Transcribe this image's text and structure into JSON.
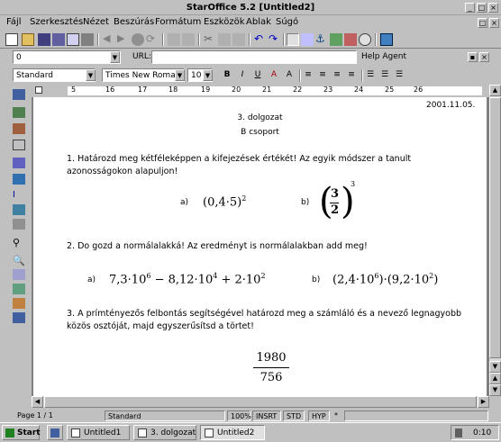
{
  "window": {
    "title": "StarOffice 5.2   [Untitled2]"
  },
  "menu": [
    "Fájl",
    "Szerkesztés",
    "Nézet",
    "Beszúrás",
    "Formátum",
    "Eszközök",
    "Ablak",
    "Súgó"
  ],
  "function_bar": {
    "url_label": "URL:",
    "url_value": "",
    "path_value": "0",
    "help_agent": "Help Agent"
  },
  "format_bar": {
    "style": "Standard",
    "font": "Times New Roman",
    "size": "10",
    "bold": "B",
    "italic": "I",
    "underline": "U"
  },
  "ruler": {
    "labels": [
      "5",
      "16",
      "17",
      "18",
      "19",
      "20",
      "21",
      "22",
      "23",
      "24",
      "25",
      "26"
    ]
  },
  "document": {
    "date": "2001.11.05.",
    "heading": "3. dolgozat",
    "group": "B csoport",
    "q1": "1. Határozd meg kétféleképpen a kifejezések értékét! Az egyik módszer a tanult azonosságokon alapuljon!",
    "q1_a_label": "a)",
    "q1_a_expr": "(0,4·5)",
    "q1_a_exp": "2",
    "q1_b_label": "b)",
    "q1_b_num": "3",
    "q1_b_den": "2",
    "q1_b_exp": "3",
    "q2": "2. Do gozd a normálalakká! Az eredményt is normálalakban add meg!",
    "q2_a_label": "a)",
    "q2_a_expr_1": "7,3·10",
    "q2_a_exp_1": "6",
    "q2_a_expr_2": " − 8,12·10",
    "q2_a_exp_2": "4",
    "q2_a_expr_3": " + 2·10",
    "q2_a_exp_3": "2",
    "q2_b_label": "b)",
    "q2_b_expr_1": "(2,4·10",
    "q2_b_exp_1": "6",
    "q2_b_expr_2": ")·(9,2·10",
    "q2_b_exp_2": "2",
    "q2_b_expr_3": ")",
    "q3": "3. A prímtényezős felbontás segítségével határozd meg a számláló és a nevező legnagyobb közös osztóját, majd egyszerűsítsd a törtet!",
    "q3_num": "1980",
    "q3_den": "756"
  },
  "status": {
    "page": "Page 1 / 1",
    "style": "Standard",
    "zoom": "100%",
    "mode": "INSRT",
    "std": "STD",
    "hyp": "HYP",
    "star": "*"
  },
  "taskbar": {
    "start": "Start",
    "tasks": [
      "Untitled1",
      "3. dolgozat",
      "Untitled2"
    ],
    "clock": "0:10"
  }
}
